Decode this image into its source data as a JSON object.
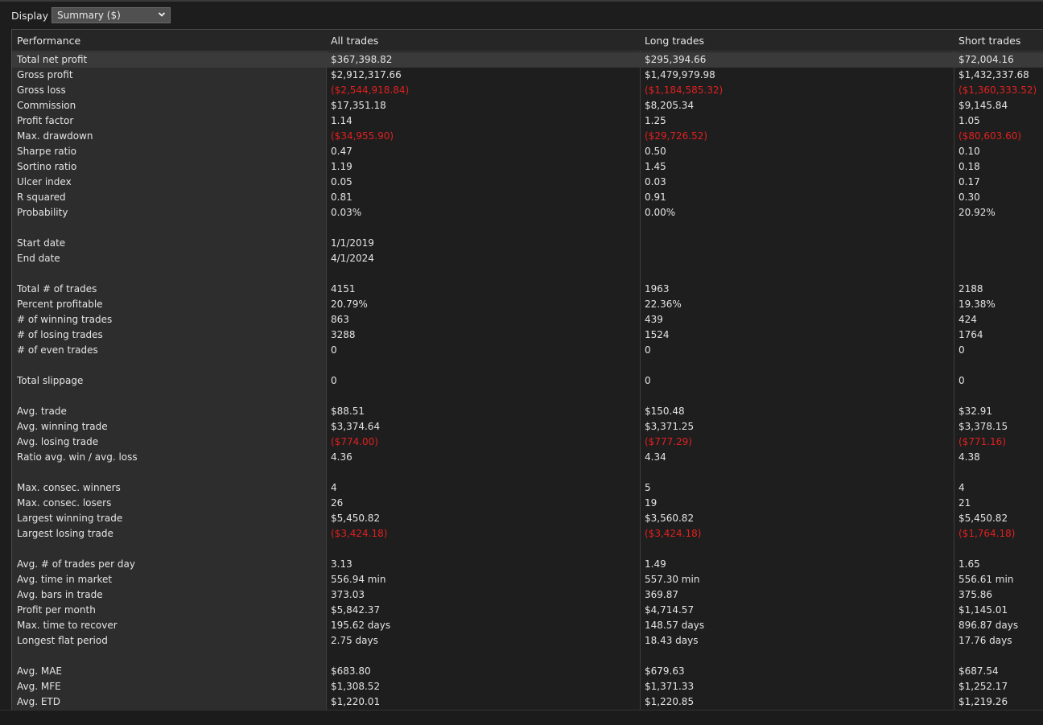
{
  "toolbar": {
    "display_label": "Display",
    "display_select_value": "Summary ($)",
    "chevron_icon": "chevron-down-icon"
  },
  "table": {
    "headers": [
      "Performance",
      "All trades",
      "Long trades",
      "Short trades"
    ],
    "rows": [
      {
        "label": "Total net profit",
        "all": "$367,398.82",
        "long": "$295,394.66",
        "short": "$72,004.16",
        "selected": true
      },
      {
        "label": "Gross profit",
        "all": "$2,912,317.66",
        "long": "$1,479,979.98",
        "short": "$1,432,337.68"
      },
      {
        "label": "Gross loss",
        "all": "($2,544,918.84)",
        "long": "($1,184,585.32)",
        "short": "($1,360,333.52)",
        "negative": true
      },
      {
        "label": "Commission",
        "all": "$17,351.18",
        "long": "$8,205.34",
        "short": "$9,145.84"
      },
      {
        "label": "Profit factor",
        "all": "1.14",
        "long": "1.25",
        "short": "1.05"
      },
      {
        "label": "Max. drawdown",
        "all": "($34,955.90)",
        "long": "($29,726.52)",
        "short": "($80,603.60)",
        "negative": true
      },
      {
        "label": "Sharpe ratio",
        "all": "0.47",
        "long": "0.50",
        "short": "0.10"
      },
      {
        "label": "Sortino ratio",
        "all": "1.19",
        "long": "1.45",
        "short": "0.18"
      },
      {
        "label": "Ulcer index",
        "all": "0.05",
        "long": "0.03",
        "short": "0.17"
      },
      {
        "label": "R squared",
        "all": "0.81",
        "long": "0.91",
        "short": "0.30"
      },
      {
        "label": "Probability",
        "all": "0.03%",
        "long": "0.00%",
        "short": "20.92%"
      },
      {
        "label": "",
        "all": "",
        "long": "",
        "short": ""
      },
      {
        "label": "Start date",
        "all": "1/1/2019",
        "long": "",
        "short": ""
      },
      {
        "label": "End date",
        "all": "4/1/2024",
        "long": "",
        "short": ""
      },
      {
        "label": "",
        "all": "",
        "long": "",
        "short": ""
      },
      {
        "label": "Total # of trades",
        "all": "4151",
        "long": "1963",
        "short": "2188"
      },
      {
        "label": "Percent profitable",
        "all": "20.79%",
        "long": "22.36%",
        "short": "19.38%"
      },
      {
        "label": "# of winning trades",
        "all": "863",
        "long": "439",
        "short": "424"
      },
      {
        "label": "# of losing trades",
        "all": "3288",
        "long": "1524",
        "short": "1764"
      },
      {
        "label": "# of even trades",
        "all": "0",
        "long": "0",
        "short": "0"
      },
      {
        "label": "",
        "all": "",
        "long": "",
        "short": ""
      },
      {
        "label": "Total slippage",
        "all": "0",
        "long": "0",
        "short": "0"
      },
      {
        "label": "",
        "all": "",
        "long": "",
        "short": ""
      },
      {
        "label": "Avg. trade",
        "all": "$88.51",
        "long": "$150.48",
        "short": "$32.91"
      },
      {
        "label": "Avg. winning trade",
        "all": "$3,374.64",
        "long": "$3,371.25",
        "short": "$3,378.15"
      },
      {
        "label": "Avg. losing trade",
        "all": "($774.00)",
        "long": "($777.29)",
        "short": "($771.16)",
        "negative": true
      },
      {
        "label": "Ratio avg. win / avg. loss",
        "all": "4.36",
        "long": "4.34",
        "short": "4.38"
      },
      {
        "label": "",
        "all": "",
        "long": "",
        "short": ""
      },
      {
        "label": "Max. consec. winners",
        "all": "4",
        "long": "5",
        "short": "4"
      },
      {
        "label": "Max. consec. losers",
        "all": "26",
        "long": "19",
        "short": "21"
      },
      {
        "label": "Largest winning trade",
        "all": "$5,450.82",
        "long": "$3,560.82",
        "short": "$5,450.82"
      },
      {
        "label": "Largest losing trade",
        "all": "($3,424.18)",
        "long": "($3,424.18)",
        "short": "($1,764.18)",
        "negative": true
      },
      {
        "label": "",
        "all": "",
        "long": "",
        "short": ""
      },
      {
        "label": "Avg. # of trades per day",
        "all": "3.13",
        "long": "1.49",
        "short": "1.65"
      },
      {
        "label": "Avg. time in market",
        "all": "556.94 min",
        "long": "557.30 min",
        "short": "556.61 min"
      },
      {
        "label": "Avg. bars in trade",
        "all": "373.03",
        "long": "369.87",
        "short": "375.86"
      },
      {
        "label": "Profit per month",
        "all": "$5,842.37",
        "long": "$4,714.57",
        "short": "$1,145.01"
      },
      {
        "label": "Max. time to recover",
        "all": "195.62 days",
        "long": "148.57 days",
        "short": "896.87 days"
      },
      {
        "label": "Longest flat period",
        "all": "2.75 days",
        "long": "18.43 days",
        "short": "17.76 days"
      },
      {
        "label": "",
        "all": "",
        "long": "",
        "short": ""
      },
      {
        "label": "Avg. MAE",
        "all": "$683.80",
        "long": "$679.63",
        "short": "$687.54"
      },
      {
        "label": "Avg. MFE",
        "all": "$1,308.52",
        "long": "$1,371.33",
        "short": "$1,252.17"
      },
      {
        "label": "Avg. ETD",
        "all": "$1,220.01",
        "long": "$1,220.85",
        "short": "$1,219.26"
      }
    ]
  },
  "colors": {
    "negative": "#e02020",
    "background": "#1d1d1d",
    "label_column": "#2d2d2d",
    "selected_row": "#3a3a3a"
  }
}
